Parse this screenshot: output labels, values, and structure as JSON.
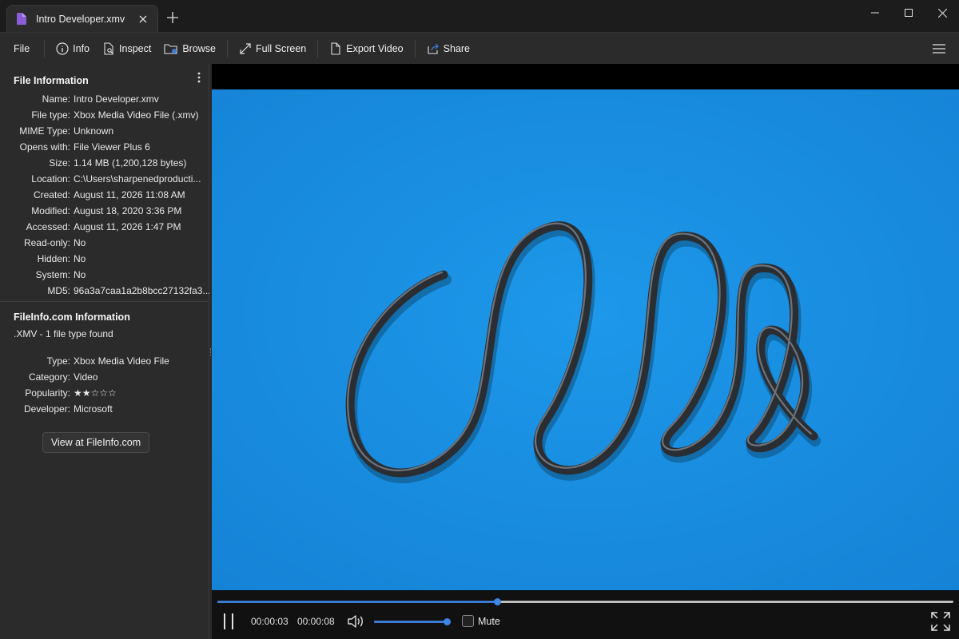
{
  "titlebar": {
    "tab_title": "Intro Developer.xmv",
    "icons": {
      "file": "file-purple-icon",
      "close": "close-icon",
      "new_tab": "plus-icon",
      "minimize": "minimize-icon",
      "maximize": "maximize-icon",
      "window_close": "close-icon"
    },
    "accent": "#8a5cd6"
  },
  "toolbar": {
    "file_label": "File",
    "info_label": "Info",
    "inspect_label": "Inspect",
    "browse_label": "Browse",
    "fullscreen_label": "Full Screen",
    "export_label": "Export Video",
    "share_label": "Share",
    "menu_icon": "hamburger-icon"
  },
  "file_info": {
    "title": "File Information",
    "rows": [
      {
        "k": "Name:",
        "v": "Intro Developer.xmv"
      },
      {
        "k": "File type:",
        "v": "Xbox Media Video File (.xmv)"
      },
      {
        "k": "MIME Type:",
        "v": "Unknown"
      },
      {
        "k": "Opens with:",
        "v": "File Viewer Plus 6"
      },
      {
        "k": "Size:",
        "v": "1.14 MB (1,200,128 bytes)"
      },
      {
        "k": "Location:",
        "v": "C:\\Users\\sharpenedproducti..."
      },
      {
        "k": "Created:",
        "v": "August 11, 2026 11:08 AM"
      },
      {
        "k": "Modified:",
        "v": "August 18, 2020 3:36 PM"
      },
      {
        "k": "Accessed:",
        "v": "August 11, 2026 1:47 PM"
      },
      {
        "k": "Read-only:",
        "v": "No"
      },
      {
        "k": "Hidden:",
        "v": "No"
      },
      {
        "k": "System:",
        "v": "No"
      },
      {
        "k": "MD5:",
        "v": "96a3a7caa1a2b8bcc27132fa3..."
      }
    ]
  },
  "fileinfo_com": {
    "title": "FileInfo.com Information",
    "subtitle": ".XMV - 1 file type found",
    "rows": [
      {
        "k": "Type:",
        "v": "Xbox Media Video File"
      },
      {
        "k": "Category:",
        "v": "Video"
      },
      {
        "k": "Popularity:",
        "v": "★★☆☆☆"
      },
      {
        "k": "Developer:",
        "v": "Microsoft"
      }
    ],
    "button_label": "View at FileInfo.com"
  },
  "player": {
    "current_time": "00:00:03",
    "total_time": "00:00:08",
    "progress": 0.38,
    "volume": 1.0,
    "mute_label": "Mute",
    "muted": false,
    "video_bg": "#1a8fe3",
    "seek_color": "#3a7bd5"
  }
}
